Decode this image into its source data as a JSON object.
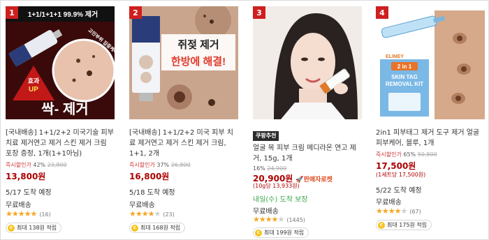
{
  "colors": {
    "rank_badge": "#cf1f1f",
    "price": "#ae0000",
    "star": "#f5a623",
    "green_text": "#3aa64c"
  },
  "products": [
    {
      "rank": "1",
      "image_text": {
        "top": "1+1/1+1+1 99.9% 제거",
        "badge": "효과\nUP",
        "bottom": "싹- 제거",
        "side": "고민부위 집중케어"
      },
      "title": "[국내배송] 1+1/2+2 미국기술 피부 치료 제거연고 제거 스킨 제거 크림 포장 증정, 1개(1+1아님)",
      "discount_label": "즉시할인가",
      "discount_pct": "42%",
      "original_price": "23,800",
      "price": "13,800원",
      "delivery_date": "5/17 도착 예정",
      "shipping": "무료배송",
      "rating": 5,
      "review_count": "(16)",
      "reward": "최대 138원 적립"
    },
    {
      "rank": "2",
      "image_text": {
        "line1": "쥐젖 제거",
        "line2": "한방에 해결!"
      },
      "title": "[국내배송] 1+1/2+2 미국 피부 치료 제거연고 제거 스킨 제거 크림, 1+1, 2개",
      "discount_label": "즉시할인가",
      "discount_pct": "37%",
      "original_price": "26,800",
      "price": "16,800원",
      "delivery_date": "5/18 도착 예정",
      "shipping": "무료배송",
      "rating": 4.5,
      "review_count": "(23)",
      "reward": "최대 168원 적립"
    },
    {
      "rank": "3",
      "badge": "쿠팡추천",
      "title": "얼굴 목 피부 크림 메디라온 연고 제거, 15g, 1개",
      "discount_pct": "16%",
      "original_price": "24,900",
      "price": "20,900원",
      "rocket": "🚀판매자로켓",
      "unit_price": "(10g당 13,933원)",
      "delivery_date": "내일(수) 도착 보장",
      "shipping": "무료배송",
      "rating": 4,
      "review_count": "(1445)",
      "reward": "최대 199원 적립"
    },
    {
      "rank": "4",
      "image_text": {
        "badge": "2 in 1",
        "line1": "SKIN TAG",
        "line2": "REMOVAL KIT",
        "brand": "ELIMEY"
      },
      "title": "2in1 피부태그 제거 도구 제거 얼굴 피부케어, 블루, 1개",
      "discount_label": "즉시할인가",
      "discount_pct": "65%",
      "original_price": "50,800",
      "price": "17,500원",
      "unit_price": "(1세트당 17,500원)",
      "delivery_date": "5/22 도착 예정",
      "shipping": "무료배송",
      "rating": 4.5,
      "review_count": "(67)",
      "reward": "최대 175원 적립"
    }
  ]
}
